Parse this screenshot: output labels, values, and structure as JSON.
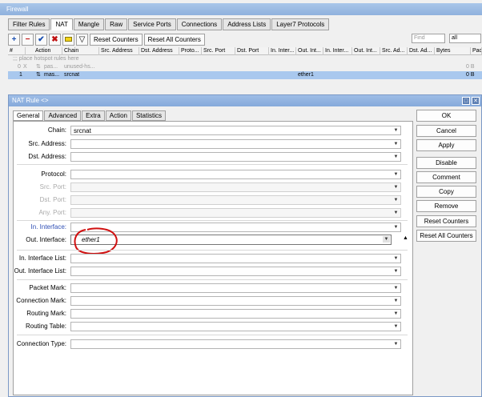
{
  "window_title": "Firewall",
  "tabs": [
    "Filter Rules",
    "NAT",
    "Mangle",
    "Raw",
    "Service Ports",
    "Connections",
    "Address Lists",
    "Layer7 Protocols"
  ],
  "toolbar": {
    "reset_counters": "Reset Counters",
    "reset_all_counters": "Reset All Counters",
    "find_placeholder": "Find",
    "filter_value": "all"
  },
  "table": {
    "columns": [
      "#",
      "Action",
      "Chain",
      "Src. Address",
      "Dst. Address",
      "Proto...",
      "Src. Port",
      "Dst. Port",
      "In. Inter...",
      "Out. Int...",
      "In. Inter...",
      "Out. Int...",
      "Src. Ad...",
      "Dst. Ad...",
      "Bytes",
      "Pac"
    ],
    "comment_row": ";;; place hotspot rules here",
    "rows": [
      {
        "num": "0",
        "flag": "X",
        "action": "pas...",
        "chain": "unused-hs...",
        "out_interface": "",
        "bytes": "0 B"
      },
      {
        "num": "1",
        "flag": "",
        "action": "mas...",
        "chain": "srcnat",
        "out_interface": "ether1",
        "bytes": "0 B"
      }
    ]
  },
  "dialog": {
    "title": "NAT Rule <>",
    "tabs": [
      "General",
      "Advanced",
      "Extra",
      "Action",
      "Statistics"
    ],
    "fields": {
      "chain_label": "Chain:",
      "chain_value": "srcnat",
      "src_address_label": "Src. Address:",
      "dst_address_label": "Dst. Address:",
      "protocol_label": "Protocol:",
      "src_port_label": "Src. Port:",
      "dst_port_label": "Dst. Port:",
      "any_port_label": "Any. Port:",
      "in_interface_label": "In. Interface:",
      "out_interface_label": "Out. Interface:",
      "out_interface_value": "ether1",
      "in_interface_list_label": "In. Interface List:",
      "out_interface_list_label": "Out. Interface List:",
      "packet_mark_label": "Packet Mark:",
      "connection_mark_label": "Connection Mark:",
      "routing_mark_label": "Routing Mark:",
      "routing_table_label": "Routing Table:",
      "connection_type_label": "Connection Type:"
    },
    "buttons": [
      "OK",
      "Cancel",
      "Apply",
      "Disable",
      "Comment",
      "Copy",
      "Remove",
      "Reset Counters",
      "Reset All Counters"
    ]
  },
  "colors": {
    "selection": "#a9c8ee",
    "annotation": "#d01010",
    "title_bar": "#9ebde6"
  }
}
